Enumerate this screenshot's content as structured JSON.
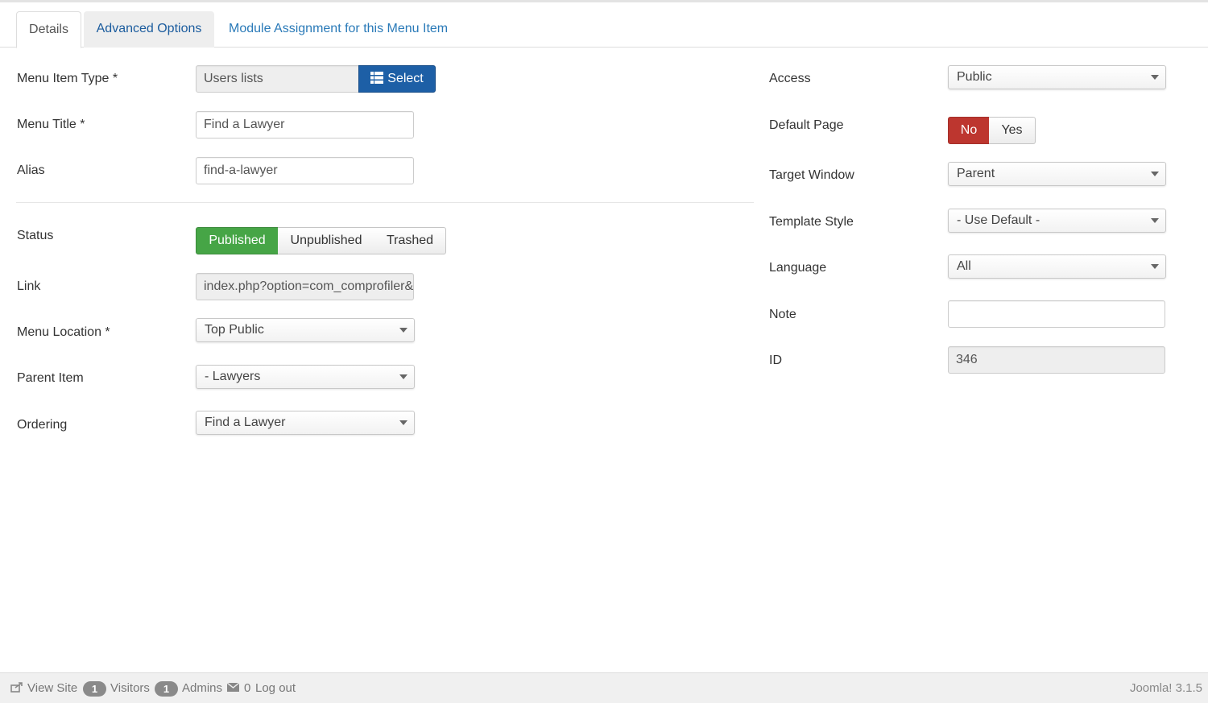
{
  "tabs": {
    "details": "Details",
    "advanced": "Advanced Options",
    "module_assignment": "Module Assignment for this Menu Item"
  },
  "left": {
    "menu_item_type": {
      "label": "Menu Item Type *",
      "value": "Users lists",
      "select_button": "Select"
    },
    "menu_title": {
      "label": "Menu Title *",
      "value": "Find a Lawyer"
    },
    "alias": {
      "label": "Alias",
      "value": "find-a-lawyer"
    },
    "status": {
      "label": "Status",
      "options": [
        "Published",
        "Unpublished",
        "Trashed"
      ],
      "selected": "Published"
    },
    "link": {
      "label": "Link",
      "value": "index.php?option=com_comprofiler&"
    },
    "menu_location": {
      "label": "Menu Location *",
      "value": "Top Public"
    },
    "parent_item": {
      "label": "Parent Item",
      "value": "- Lawyers"
    },
    "ordering": {
      "label": "Ordering",
      "value": "Find a Lawyer"
    }
  },
  "right": {
    "access": {
      "label": "Access",
      "value": "Public"
    },
    "default_page": {
      "label": "Default Page",
      "options": [
        "No",
        "Yes"
      ],
      "selected": "No"
    },
    "target_window": {
      "label": "Target Window",
      "value": "Parent"
    },
    "template_style": {
      "label": "Template Style",
      "value": "- Use Default -"
    },
    "language": {
      "label": "Language",
      "value": "All"
    },
    "note": {
      "label": "Note",
      "value": ""
    },
    "id": {
      "label": "ID",
      "value": "346"
    }
  },
  "footer": {
    "view_site": "View Site",
    "visitors_count": "1",
    "visitors": "Visitors",
    "admins_count": "1",
    "admins": "Admins",
    "messages_count": "0",
    "logout": "Log out",
    "version": "Joomla! 3.1.5"
  },
  "colors": {
    "published_green": "#46a546",
    "no_red": "#bd362f",
    "select_blue": "#1d5fa6",
    "tab_link_blue": "#2a7ab8"
  }
}
